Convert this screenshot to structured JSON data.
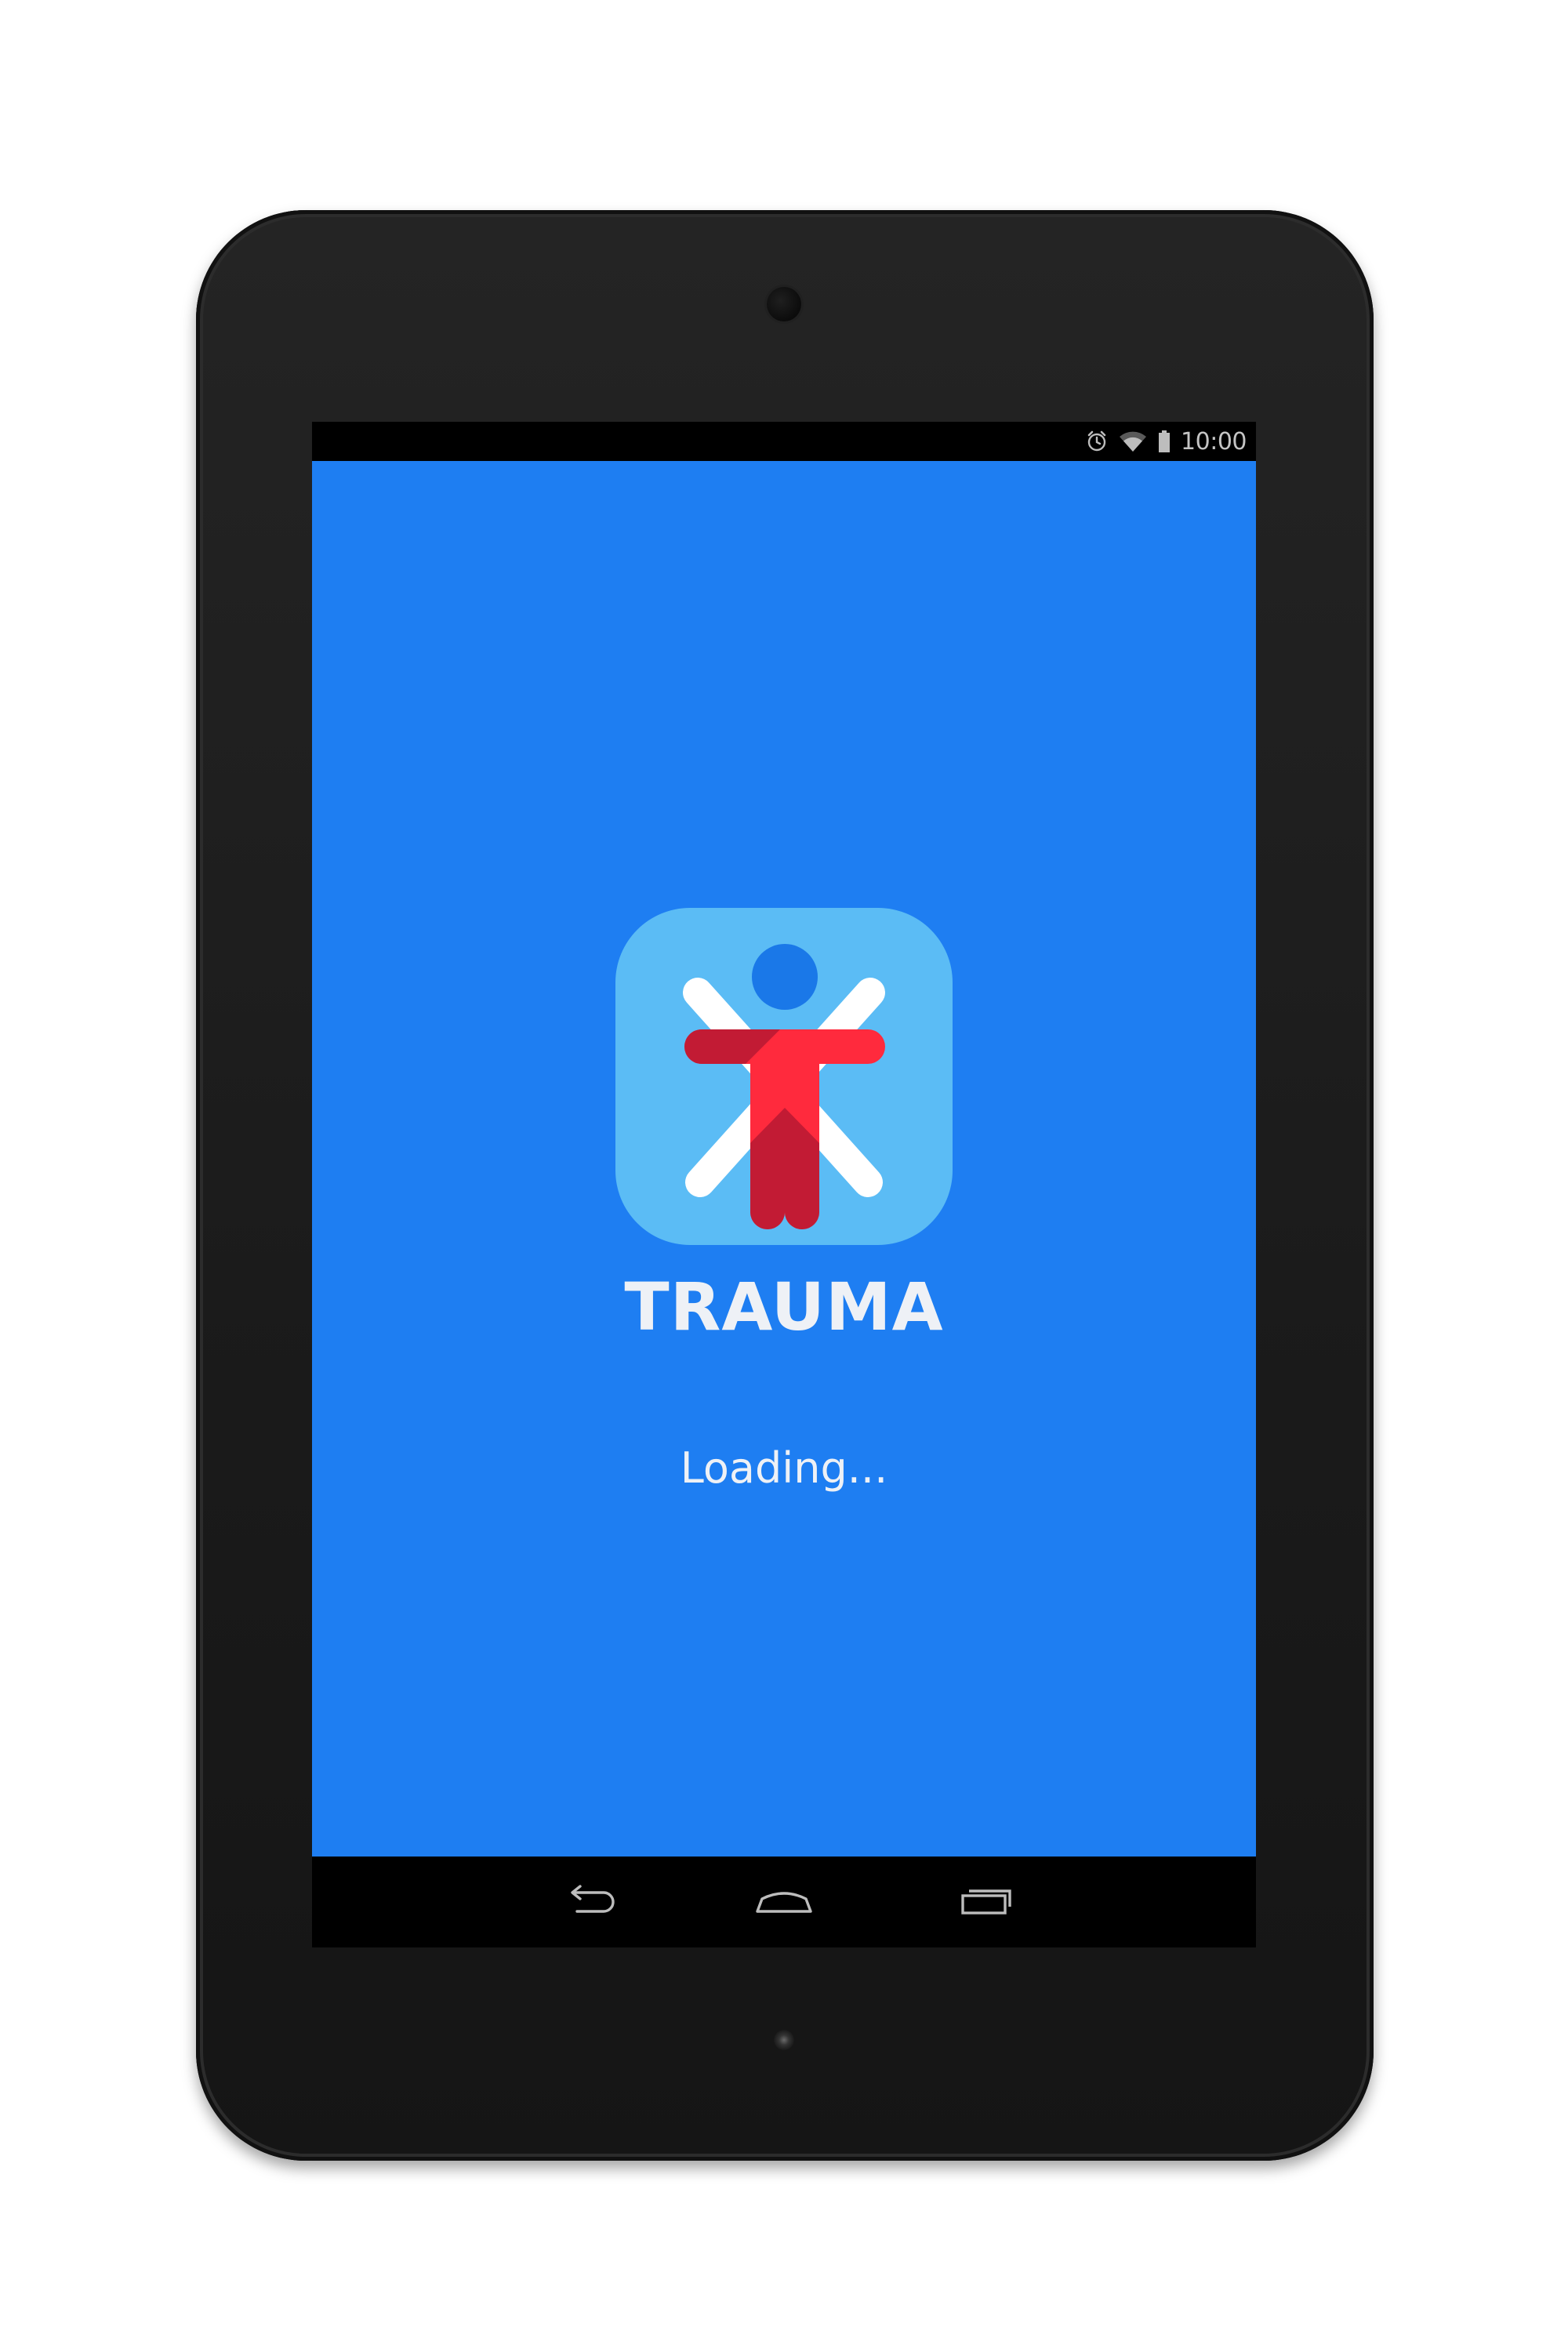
{
  "status_bar": {
    "time": "10:00",
    "icons": [
      "alarm-icon",
      "wifi-icon",
      "battery-icon"
    ]
  },
  "app": {
    "name": "TRAUMA",
    "loading_text": "Loading...",
    "background_color": "#1e7ef2",
    "icon": "trauma-figure-logo"
  },
  "nav_bar": {
    "buttons": [
      "back-icon",
      "home-icon",
      "recents-icon"
    ]
  },
  "device": {
    "type": "tablet",
    "bezel_color": "#1c1c1c"
  }
}
